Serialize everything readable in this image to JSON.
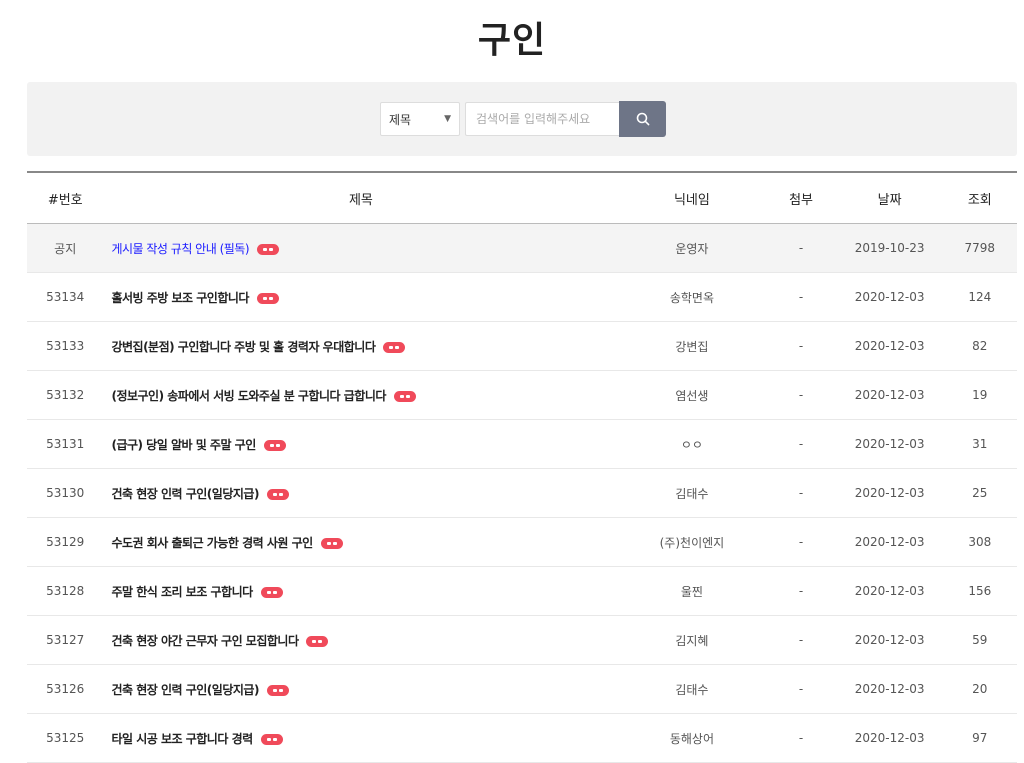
{
  "page": {
    "title": "구인"
  },
  "search": {
    "select_value": "제목",
    "placeholder": "검색어를 입력해주세요",
    "button_icon": "search-icon"
  },
  "table": {
    "headers": [
      "#번호",
      "제목",
      "닉네임",
      "첨부",
      "날짜",
      "조회"
    ],
    "rows": [
      {
        "num": "공지",
        "title": "게시물 작성 규칙 안내 (필독)",
        "nick": "운영자",
        "attach": "-",
        "date": "2019-10-23",
        "views": "7798",
        "notice": true
      },
      {
        "num": "53134",
        "title": "홀서빙 주방 보조 구인합니다",
        "nick": "송학면옥",
        "attach": "-",
        "date": "2020-12-03",
        "views": "124"
      },
      {
        "num": "53133",
        "title": "강변집(분점) 구인합니다 주방 및 홀 경력자 우대합니다",
        "nick": "강변집",
        "attach": "-",
        "date": "2020-12-03",
        "views": "82"
      },
      {
        "num": "53132",
        "title": "(정보구인) 송파에서 서빙 도와주실 분 구합니다 급합니다",
        "nick": "염선생",
        "attach": "-",
        "date": "2020-12-03",
        "views": "19"
      },
      {
        "num": "53131",
        "title": "(급구) 당일 알바 및 주말 구인",
        "nick": "ㅇㅇ",
        "attach": "-",
        "date": "2020-12-03",
        "views": "31"
      },
      {
        "num": "53130",
        "title": "건축 현장 인력 구인(일당지급)",
        "nick": "김태수",
        "attach": "-",
        "date": "2020-12-03",
        "views": "25"
      },
      {
        "num": "53129",
        "title": "수도권 회사 출퇴근 가능한 경력 사원 구인",
        "nick": "(주)천이엔지",
        "attach": "-",
        "date": "2020-12-03",
        "views": "308"
      },
      {
        "num": "53128",
        "title": "주말 한식 조리 보조 구합니다",
        "nick": "울찐",
        "attach": "-",
        "date": "2020-12-03",
        "views": "156"
      },
      {
        "num": "53127",
        "title": "건축 현장 야간 근무자 구인 모집합니다",
        "nick": "김지혜",
        "attach": "-",
        "date": "2020-12-03",
        "views": "59"
      },
      {
        "num": "53126",
        "title": "건축 현장 인력 구인(일당지급)",
        "nick": "김태수",
        "attach": "-",
        "date": "2020-12-03",
        "views": "20"
      },
      {
        "num": "53125",
        "title": "타일 시공 보조 구합니다 경력",
        "nick": "동해상어",
        "attach": "-",
        "date": "2020-12-03",
        "views": "97"
      }
    ]
  },
  "colors": {
    "search_button": "#6e7587",
    "new_badge": "#f04a5a",
    "notice_link": "#1a1aff",
    "search_bar_bg": "#f2f2f2"
  }
}
